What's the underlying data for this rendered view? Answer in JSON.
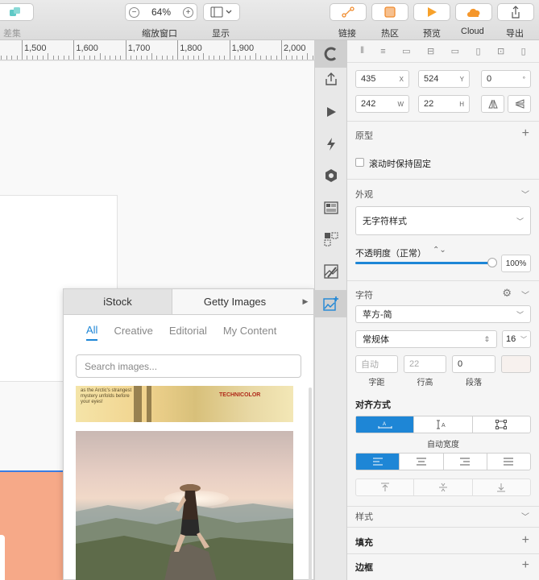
{
  "toolbar": {
    "left_label": "差集",
    "zoom": {
      "value": "64%",
      "minus": "−",
      "plus": "+",
      "label": "缩放窗口"
    },
    "display_label": "显示",
    "link_label": "链接",
    "hotspot_label": "热区",
    "preview_label": "预览",
    "cloud_label": "Cloud",
    "export_label": "导出"
  },
  "ruler": {
    "marks": [
      "1,500",
      "1,600",
      "1,700",
      "1,800",
      "1,900",
      "2,000"
    ]
  },
  "image_panel": {
    "tabs": [
      "iStock",
      "Getty Images"
    ],
    "active_tab": 1,
    "categories": [
      "All",
      "Creative",
      "Editorial",
      "My Content"
    ],
    "active_category": 0,
    "search_placeholder": "Search images...",
    "thumb1_text": "as the Arctic's strangest mystery unfolds before your eyes!",
    "thumb1_brand": "TECHNICOLOR"
  },
  "inspector": {
    "x": "435",
    "x_unit": "X",
    "y": "524",
    "y_unit": "Y",
    "rotation": "0",
    "rotation_unit": "°",
    "w": "242",
    "w_unit": "W",
    "h": "22",
    "h_unit": "H",
    "prototype_label": "原型",
    "fix_scroll_label": "滚动时保持固定",
    "appearance_label": "外观",
    "style_select": "无字符样式",
    "opacity_label": "不透明度（正常）",
    "opacity_value": "100%",
    "opacity": 1.0,
    "typography_label": "字符",
    "font_family": "苹方-简",
    "font_weight": "常规体",
    "font_size": "16",
    "spacing_placeholder": "自动",
    "line_height_placeholder": "22",
    "paragraph_value": "0",
    "spacing_label": "字距",
    "line_height_label": "行高",
    "paragraph_label": "段落",
    "alignment_label": "对齐方式",
    "auto_width_label": "自动宽度",
    "styles_label": "样式",
    "fill_label": "填充",
    "border_label": "边框"
  },
  "colors": {
    "accent": "#1e86d6",
    "peach": "#f6a988"
  }
}
